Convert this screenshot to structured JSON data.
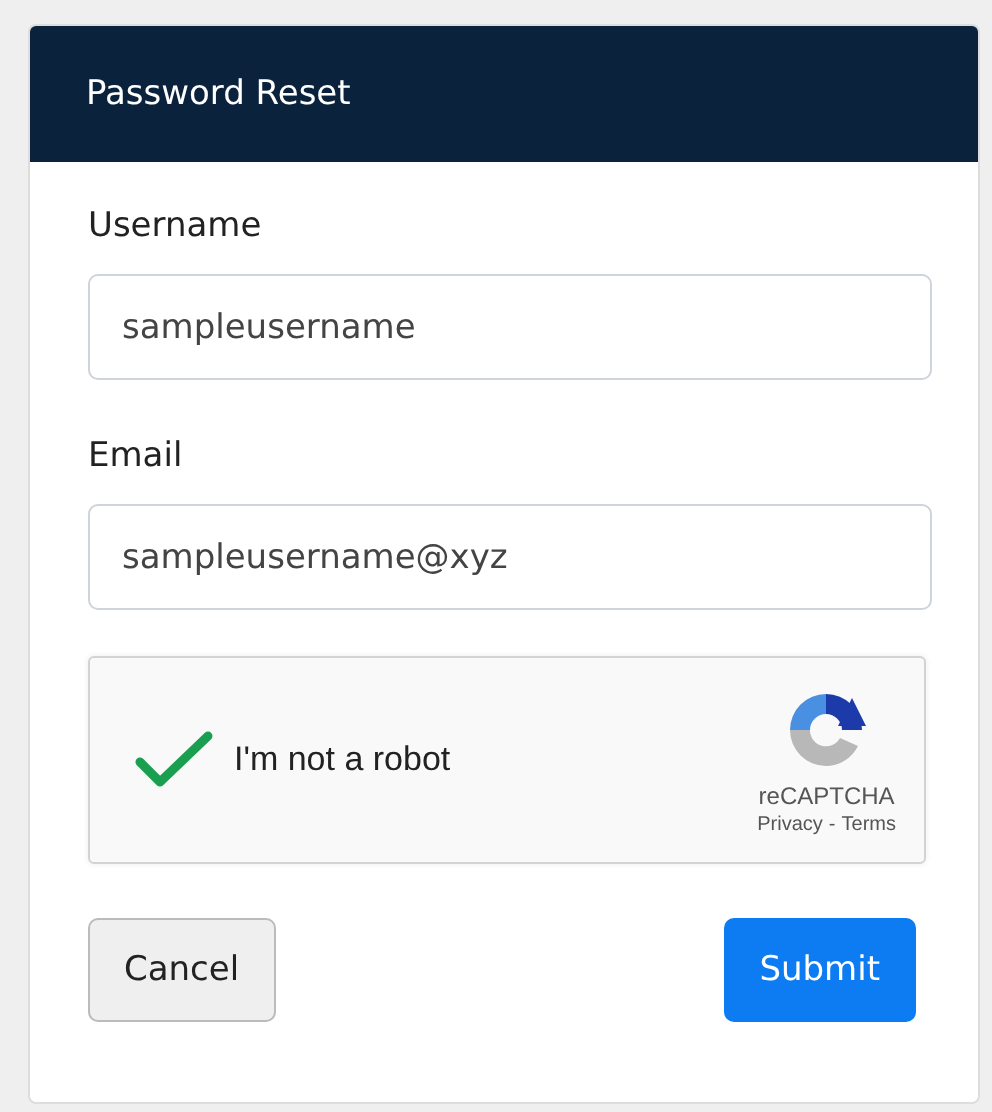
{
  "card": {
    "title": "Password Reset"
  },
  "fields": [
    {
      "label": "Username",
      "value": "sampleusername"
    },
    {
      "label": "Email",
      "value": "sampleusername@xyz"
    }
  ],
  "captcha": {
    "label": "I'm not a robot",
    "checked": true,
    "brand": "reCAPTCHA",
    "links": [
      "Privacy",
      "Terms"
    ],
    "separator": "-"
  },
  "buttons": [
    {
      "label": "Cancel",
      "kind": "secondary"
    },
    {
      "label": "Submit",
      "kind": "primary"
    }
  ]
}
